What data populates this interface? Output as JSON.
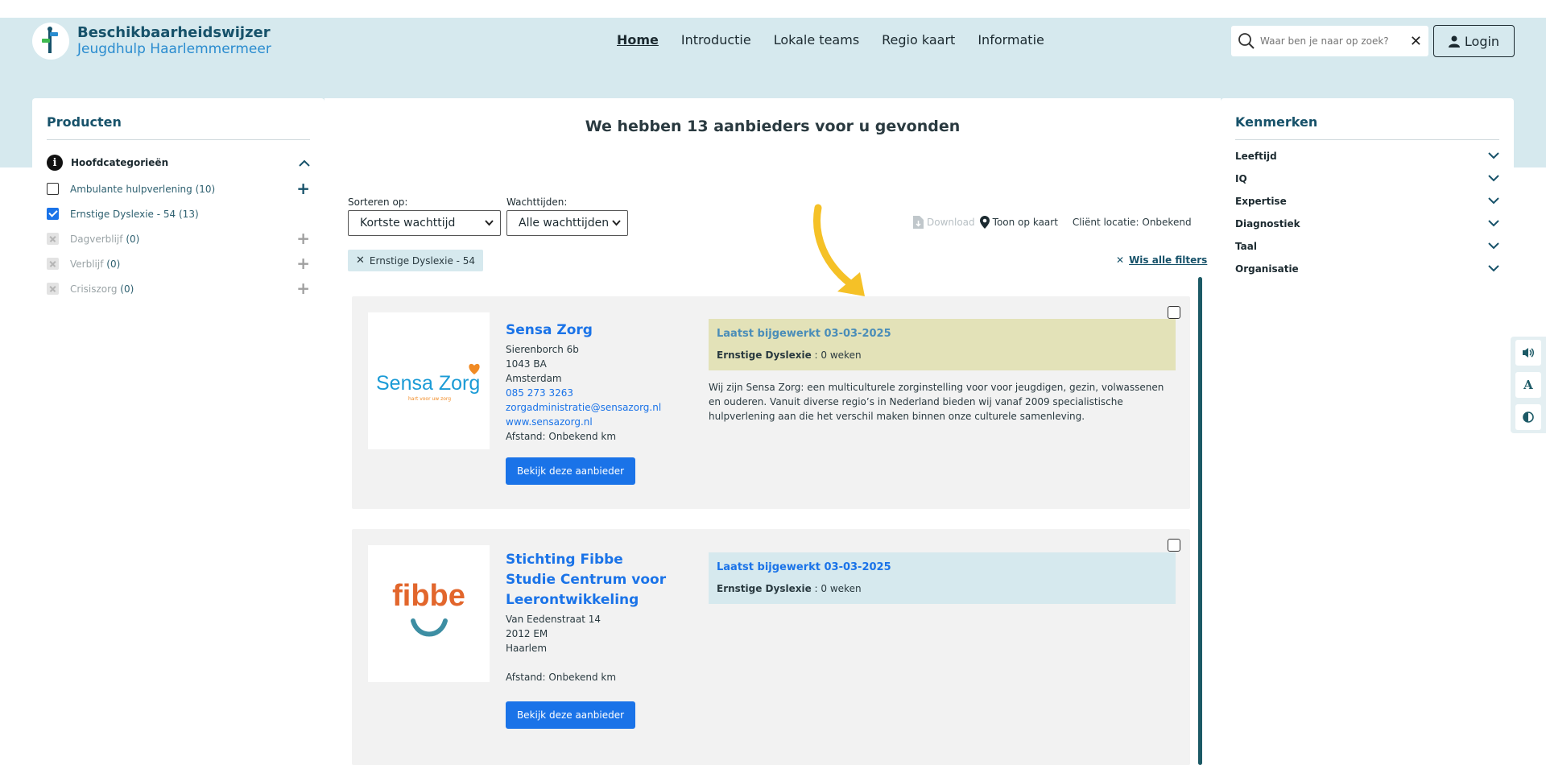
{
  "header": {
    "brand_title": "Beschikbaarheidswijzer",
    "brand_subtitle": "Jeugdhulp Haarlemmermeer",
    "nav": [
      "Home",
      "Introductie",
      "Lokale teams",
      "Regio kaart",
      "Informatie"
    ],
    "search_placeholder": "Waar ben je naar op zoek?",
    "login_label": "Login"
  },
  "products": {
    "title": "Producten",
    "group_label": "Hoofdcategorieën",
    "items": [
      {
        "label": "Ambulante hulpverlening",
        "count": "(10)",
        "state": "unchecked"
      },
      {
        "label": "Ernstige Dyslexie - 54",
        "count": "(13)",
        "state": "checked"
      },
      {
        "label": "Dagverblijf",
        "count": "(0)",
        "state": "disabled"
      },
      {
        "label": "Verblijf",
        "count": "(0)",
        "state": "disabled"
      },
      {
        "label": "Crisiszorg",
        "count": "(0)",
        "state": "disabled"
      }
    ]
  },
  "results": {
    "headline": "We hebben 13 aanbieders voor u gevonden",
    "sort_label": "Sorteren op:",
    "sort_value": "Kortste wachttijd",
    "wait_label": "Wachttijden:",
    "wait_value": "Alle wachttijden",
    "download_label": "Download",
    "map_label": "Toon op kaart",
    "client_location": "Cliënt locatie: Onbekend",
    "active_filter": "Ernstige Dyslexie - 54",
    "clear_filters": "Wis alle filters"
  },
  "kenmerken": {
    "title": "Kenmerken",
    "items": [
      "Leeftijd",
      "IQ",
      "Expertise",
      "Diagnostiek",
      "Taal",
      "Organisatie"
    ]
  },
  "providers": [
    {
      "name": "Sensa Zorg",
      "address": [
        "Sierenborch 6b",
        "1043 BA",
        "Amsterdam"
      ],
      "phone": "085 273 3263",
      "email": "zorgadministratie@sensazorg.nl",
      "website": "www.sensazorg.nl",
      "distance": "Afstand: Onbekend km",
      "button": "Bekijk deze aanbieder",
      "updated": "Laatst bijgewerkt 03-03-2025",
      "wait_product": "Ernstige Dyslexie",
      "wait_time": " : 0 weken",
      "status_color": "#e3e2b8",
      "description": "Wij zijn Sensa Zorg: een multiculturele zorginstelling voor voor jeugdigen, gezin, volwassenen en ouderen. Vanuit diverse regio’s in Nederland bieden wij vanaf 2009 specialistische hulpverlening aan die het verschil maken binnen onze culturele samenleving.",
      "logo_text": "Sensa Zorg",
      "logo_tagline": "hart voor uw zorg"
    },
    {
      "name": "Stichting Fibbe Studie Centrum voor Leerontwikkeling",
      "address": [
        "Van Eedenstraat 14",
        "2012 EM",
        "Haarlem"
      ],
      "distance": "Afstand: Onbekend km",
      "button": "Bekijk deze aanbieder",
      "updated": "Laatst bijgewerkt 03-03-2025",
      "wait_product": "Ernstige Dyslexie",
      "wait_time": " : 0 weken",
      "status_color": "#d6e9ee",
      "logo_text": "fibbe"
    }
  ],
  "colors": {
    "banner": "#d6e9ee",
    "primary": "#1a73e8",
    "dark_teal": "#17526a",
    "arrow": "#f5c127"
  },
  "tools": [
    "speaker-icon",
    "font-size-icon",
    "contrast-icon"
  ]
}
